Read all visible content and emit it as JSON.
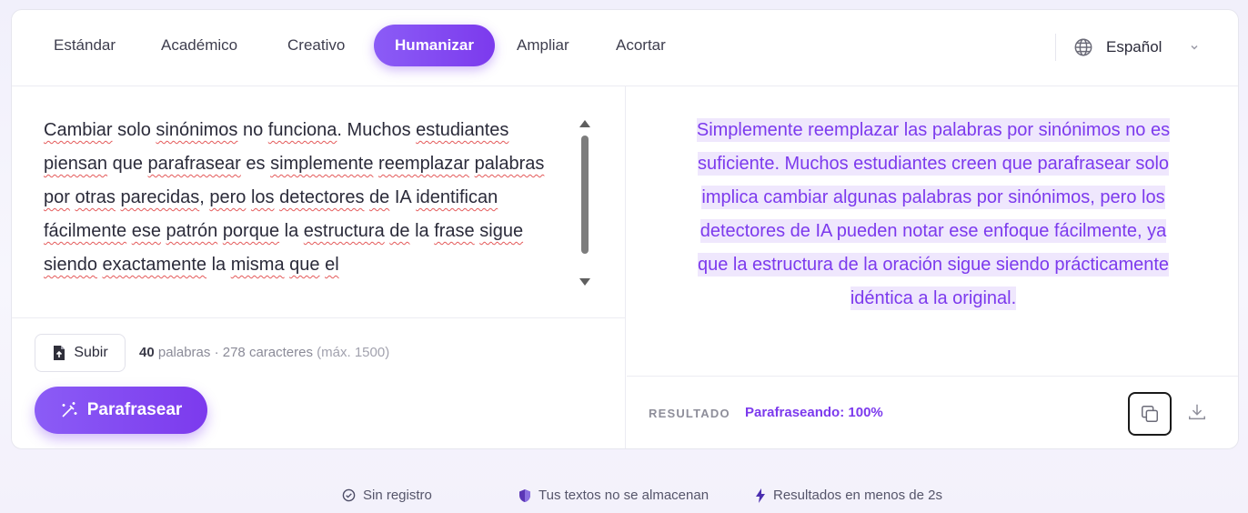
{
  "tabs": [
    {
      "label": "Estándar"
    },
    {
      "label": "Académico"
    },
    {
      "label": "Creativo"
    },
    {
      "label": "Humanizar",
      "active": true
    },
    {
      "label": "Ampliar"
    },
    {
      "label": "Acortar"
    }
  ],
  "language": {
    "selected": "Español",
    "icon": "globe-icon"
  },
  "input": {
    "segments": [
      {
        "t": "Cambiar",
        "u": true
      },
      {
        "t": " solo "
      },
      {
        "t": "sinónimos",
        "u": true
      },
      {
        "t": " no "
      },
      {
        "t": "funciona",
        "u": true
      },
      {
        "t": ". Muchos "
      },
      {
        "t": "estudiantes",
        "u": true
      },
      {
        "t": " "
      },
      {
        "t": "piensan",
        "u": true
      },
      {
        "t": " que "
      },
      {
        "t": "parafrasear",
        "u": true
      },
      {
        "t": " es "
      },
      {
        "t": "simplemente",
        "u": true
      },
      {
        "t": " "
      },
      {
        "t": "reemplazar",
        "u": true
      },
      {
        "t": " "
      },
      {
        "t": "palabras",
        "u": true
      },
      {
        "t": " "
      },
      {
        "t": "por",
        "u": true
      },
      {
        "t": " "
      },
      {
        "t": "otras",
        "u": true
      },
      {
        "t": " "
      },
      {
        "t": "parecidas",
        "u": true
      },
      {
        "t": ", "
      },
      {
        "t": "pero",
        "u": true
      },
      {
        "t": " "
      },
      {
        "t": "los",
        "u": true
      },
      {
        "t": " "
      },
      {
        "t": "detectores",
        "u": true
      },
      {
        "t": " "
      },
      {
        "t": "de",
        "u": true
      },
      {
        "t": " IA "
      },
      {
        "t": "identifican",
        "u": true
      },
      {
        "t": " "
      },
      {
        "t": "fácilmente",
        "u": true
      },
      {
        "t": " "
      },
      {
        "t": "ese",
        "u": true
      },
      {
        "t": " "
      },
      {
        "t": "patrón",
        "u": true
      },
      {
        "t": " "
      },
      {
        "t": "porque",
        "u": true
      },
      {
        "t": " la "
      },
      {
        "t": "estructura",
        "u": true
      },
      {
        "t": " "
      },
      {
        "t": "de",
        "u": true
      },
      {
        "t": " "
      },
      {
        "t": "la "
      },
      {
        "t": "frase",
        "u": true
      },
      {
        "t": " "
      },
      {
        "t": "sigue",
        "u": true
      },
      {
        "t": " "
      },
      {
        "t": "siendo",
        "u": true
      },
      {
        "t": " "
      },
      {
        "t": "exactamente",
        "u": true
      },
      {
        "t": " la "
      },
      {
        "t": "misma",
        "u": true
      },
      {
        "t": " "
      },
      {
        "t": "que",
        "u": true
      },
      {
        "t": " "
      },
      {
        "t": "el",
        "u": true
      }
    ]
  },
  "upload": {
    "label": "Subir",
    "icon": "file-upload-icon"
  },
  "counts": {
    "words": "40",
    "words_label": "palabras",
    "sep": "·",
    "chars": "278",
    "chars_label": "caracteres",
    "max": "(máx. 1500)"
  },
  "paraphrase": {
    "label": "Parafrasear",
    "icon": "magic-wand-icon"
  },
  "output": {
    "segments": [
      "Simplemente reemplazar las palabras por sinónimos no es",
      "suficiente.  Muchos estudiantes creen que parafrasear solo",
      "implica cambiar algunas palabras por sinónimos, pero los",
      "detectores de IA pueden notar ese enfoque fácilmente, ya",
      "que la estructura de la oración sigue siendo prácticamente",
      "idéntica a la original."
    ]
  },
  "result": {
    "label": "RESULTADO",
    "status": "Parafraseando: 100%"
  },
  "actions": {
    "copy_icon": "copy-icon",
    "download_icon": "download-icon"
  },
  "features": [
    {
      "icon": "check-circle-icon",
      "text": "Sin registro"
    },
    {
      "icon": "shield-icon",
      "text": "Tus textos no se almacenan"
    },
    {
      "icon": "bolt-icon",
      "text": "Resultados en menos de 2s"
    }
  ],
  "colors": {
    "accent": "#7c3aed",
    "highlight": "#efe7fd",
    "spell": "#e45a5a"
  }
}
